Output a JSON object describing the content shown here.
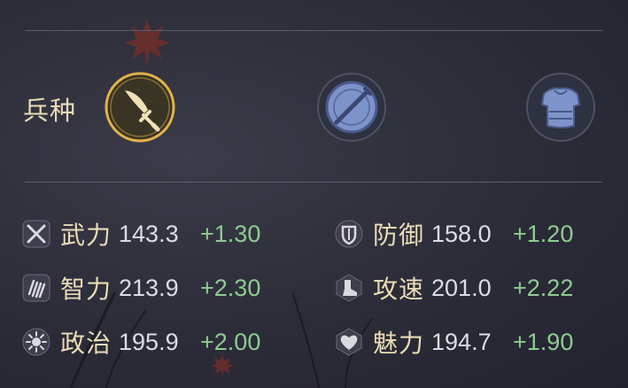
{
  "troop_section": {
    "label": "兵种",
    "types": [
      {
        "name": "sword-troop",
        "icon": "sword-icon",
        "selected": true
      },
      {
        "name": "shield-troop",
        "icon": "shield-sword-icon",
        "selected": false
      },
      {
        "name": "armor-troop",
        "icon": "armor-icon",
        "selected": false
      }
    ]
  },
  "stats": [
    {
      "icon": "crossed-swords-icon",
      "label": "武力",
      "value": "143.3",
      "bonus": "+1.30"
    },
    {
      "icon": "shield-emblem-icon",
      "label": "防御",
      "value": "158.0",
      "bonus": "+1.20"
    },
    {
      "icon": "scroll-icon",
      "label": "智力",
      "value": "213.9",
      "bonus": "+2.30"
    },
    {
      "icon": "boot-icon",
      "label": "攻速",
      "value": "201.0",
      "bonus": "+2.22"
    },
    {
      "icon": "sun-icon",
      "label": "政治",
      "value": "195.9",
      "bonus": "+2.00"
    },
    {
      "icon": "heart-icon",
      "label": "魅力",
      "value": "194.7",
      "bonus": "+1.90"
    }
  ],
  "colors": {
    "label_gold": "#e9dcb6",
    "value_white": "#dcdce4",
    "bonus_green": "#8fcb91",
    "selected_ring": "#e3b34a"
  }
}
